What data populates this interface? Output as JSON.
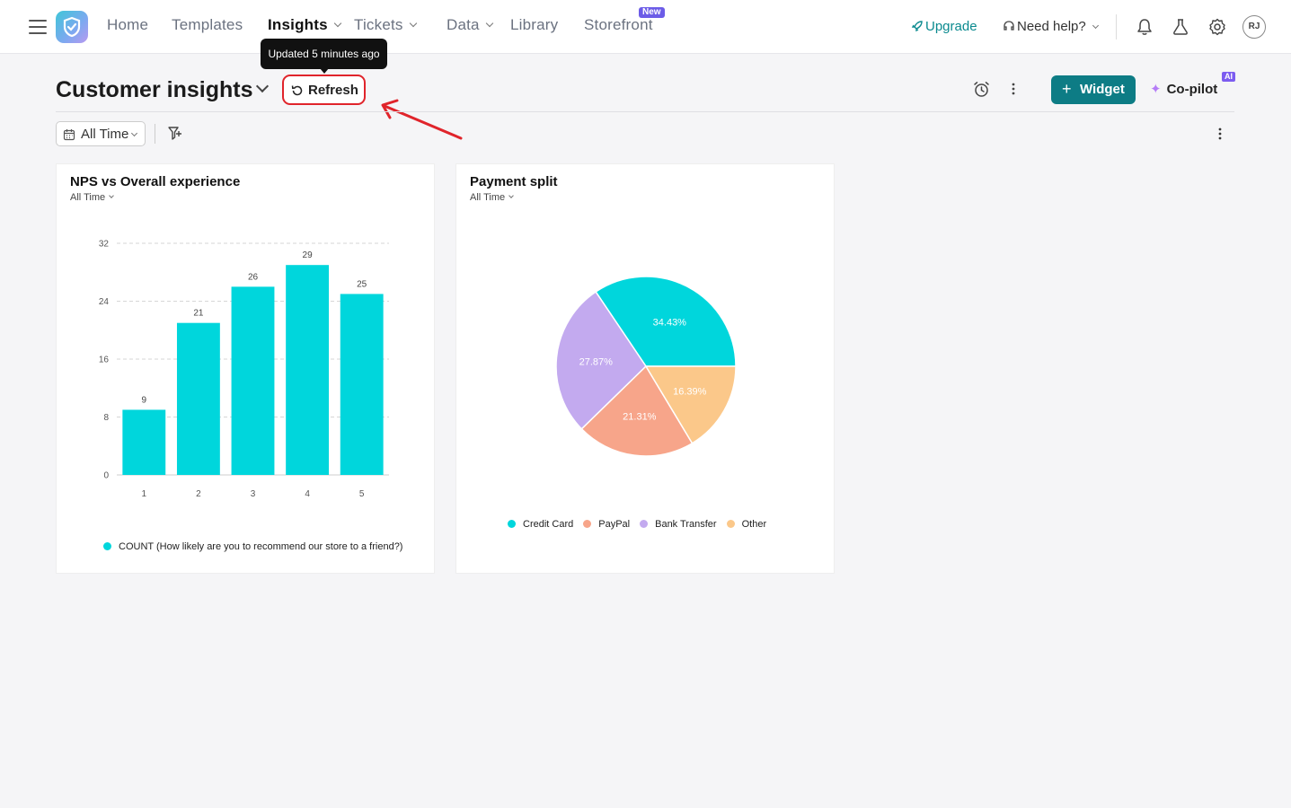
{
  "nav": {
    "items": [
      {
        "label": "Home",
        "active": false,
        "dropdown": false
      },
      {
        "label": "Templates",
        "active": false,
        "dropdown": false
      },
      {
        "label": "Insights",
        "active": true,
        "dropdown": true
      },
      {
        "label": "Tickets",
        "active": false,
        "dropdown": true
      },
      {
        "label": "Data",
        "active": false,
        "dropdown": true
      },
      {
        "label": "Library",
        "active": false,
        "dropdown": false
      },
      {
        "label": "Storefront",
        "active": false,
        "dropdown": false
      }
    ],
    "new_badge": "New",
    "upgrade_label": "Upgrade",
    "help_label": "Need help?",
    "avatar_initials": "RJ"
  },
  "tooltip": "Updated 5 minutes ago",
  "header": {
    "title": "Customer insights",
    "refresh_label": "Refresh",
    "widget_label": "Widget",
    "copilot_label": "Co-pilot",
    "ai_badge": "AI"
  },
  "filters": {
    "time_label": "All Time"
  },
  "colors": {
    "accent": "#0d7c85",
    "highlight": "#e0242b",
    "bar": "#00d6dc"
  },
  "cards": [
    {
      "title": "NPS vs Overall experience",
      "subtitle": "All Time"
    },
    {
      "title": "Payment split",
      "subtitle": "All Time"
    }
  ],
  "chart_data": [
    {
      "type": "bar",
      "categories": [
        "1",
        "2",
        "3",
        "4",
        "5"
      ],
      "series": [
        {
          "name": "COUNT (How likely are you to recommend our store to a friend?)",
          "values": [
            9,
            21,
            26,
            29,
            25
          ],
          "color": "#00d6dc"
        }
      ],
      "data_labels": [
        "9",
        "21",
        "26",
        "29",
        "25"
      ],
      "yticks": [
        0,
        8,
        16,
        24,
        32
      ],
      "ylim": [
        0,
        32
      ],
      "grid": true,
      "legend": "bottom"
    },
    {
      "type": "pie",
      "labels": [
        "Credit Card",
        "Bank Transfer",
        "PayPal",
        "Other"
      ],
      "values": [
        34.43,
        27.87,
        21.31,
        16.39
      ],
      "value_labels": [
        "34.43%",
        "27.87%",
        "21.31%",
        "16.39%"
      ],
      "colors": [
        "#00d6dc",
        "#c3aaef",
        "#f7a58a",
        "#fbc88a"
      ],
      "legend_order": [
        "Credit Card",
        "PayPal",
        "Bank Transfer",
        "Other"
      ],
      "legend": "bottom"
    }
  ]
}
